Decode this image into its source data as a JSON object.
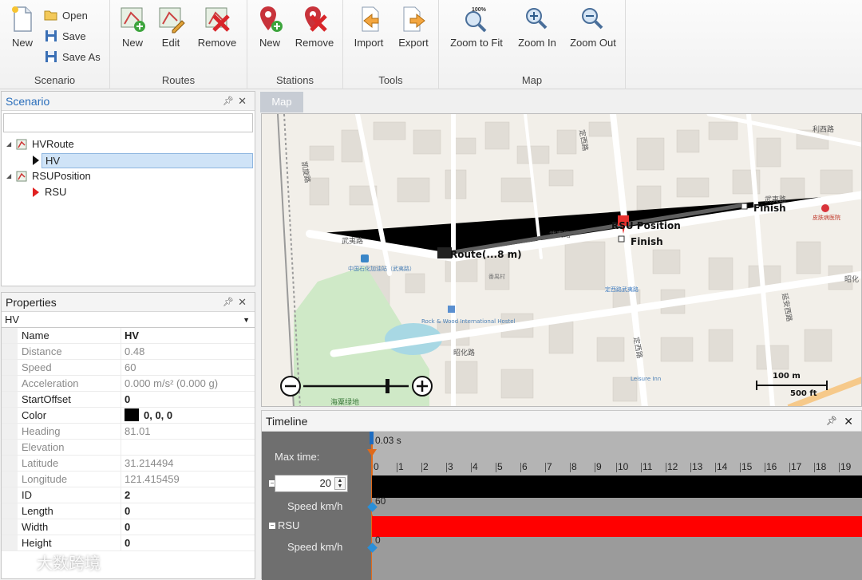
{
  "ribbon": {
    "scenario": {
      "label": "Scenario",
      "new": "New",
      "open": "Open",
      "save": "Save",
      "save_as": "Save As"
    },
    "routes": {
      "label": "Routes",
      "new": "New",
      "edit": "Edit",
      "remove": "Remove"
    },
    "stations": {
      "label": "Stations",
      "new": "New",
      "remove": "Remove"
    },
    "tools": {
      "label": "Tools",
      "import": "Import",
      "export": "Export"
    },
    "map": {
      "label": "Map",
      "zoom_fit": "Zoom to Fit",
      "zoom_fit_badge": "100%",
      "zoom_in": "Zoom In",
      "zoom_out": "Zoom Out"
    }
  },
  "scenario_panel": {
    "title": "Scenario",
    "tree": [
      {
        "label": "HVRoute",
        "children": [
          "HV"
        ]
      },
      {
        "label": "RSUPosition",
        "children": [
          "RSU"
        ]
      }
    ]
  },
  "properties_panel": {
    "title": "Properties",
    "selected": "HV",
    "rows": [
      {
        "name": "Name",
        "value": "HV"
      },
      {
        "name": "Distance",
        "value": "0.48"
      },
      {
        "name": "Speed",
        "value": "60"
      },
      {
        "name": "Acceleration",
        "value": "0.000 m/s² (0.000 g)"
      },
      {
        "name": "StartOffset",
        "value": "0"
      },
      {
        "name": "Color",
        "value": "0, 0, 0"
      },
      {
        "name": "Heading",
        "value": "81.01"
      },
      {
        "name": "Elevation",
        "value": ""
      },
      {
        "name": "Latitude",
        "value": "31.214494"
      },
      {
        "name": "Longitude",
        "value": "121.415459"
      },
      {
        "name": "ID",
        "value": "2"
      },
      {
        "name": "Length",
        "value": "0"
      },
      {
        "name": "Width",
        "value": "0"
      },
      {
        "name": "Height",
        "value": "0"
      }
    ]
  },
  "map": {
    "tab": "Map",
    "route_label": "Route(...8 m)",
    "rsu_label": "RSU Position",
    "finish1": "Finish",
    "finish2": "Finish",
    "scale_m": "100 m",
    "scale_ft": "500 ft",
    "streets": {
      "wuyi_left": "武夷路",
      "wuyi_mid": "武夷路",
      "wuyi_right": "武夷路",
      "zhaohua": "昭化路",
      "dingxi": "定西路",
      "dingxi2": "定西路",
      "lixi": "利西路",
      "kaixuan": "凯旋路",
      "yanan": "延安西路",
      "zhaohua_right": "昭化",
      "xianggang": "定西路武夷路"
    },
    "pois": {
      "gas": "中国石化加油站（武夷路）",
      "hospital": "皮肤病医院",
      "hostel": "Rock & Wood International Hostel",
      "inn": "Leisure Inn",
      "greenland": "海粟绿地",
      "village": "番禺村"
    },
    "colors": {
      "route": "#222222",
      "rsu": "#e8312f",
      "park": "#cfe9c7",
      "water": "#a8d8e4"
    }
  },
  "timeline": {
    "title": "Timeline",
    "current_time": "0.03 s",
    "max_time_label": "Max time:",
    "max_time_value": "20",
    "ticks": [
      "0",
      "1",
      "2",
      "3",
      "4",
      "5",
      "6",
      "7",
      "8",
      "9",
      "10",
      "11",
      "12",
      "13",
      "14",
      "15",
      "16",
      "17",
      "18",
      "19"
    ],
    "tracks": [
      {
        "name": "",
        "sub": "Speed km/h",
        "value": "60",
        "color": "#000000"
      },
      {
        "name": "RSU",
        "sub": "Speed km/h",
        "value": "0",
        "color": "#ff0000"
      }
    ]
  },
  "watermark": "大数跨境"
}
